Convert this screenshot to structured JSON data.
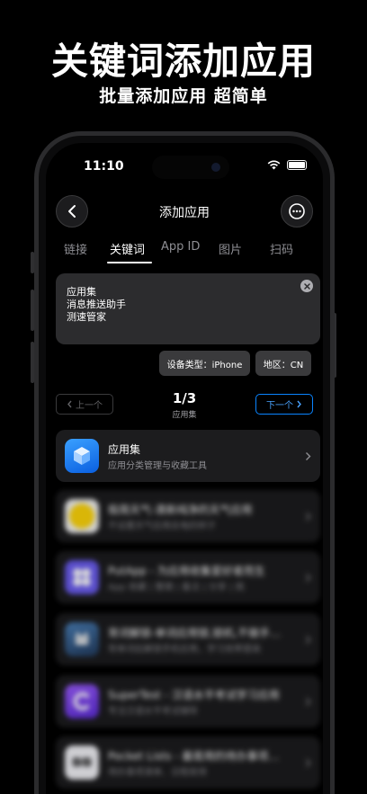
{
  "promo": {
    "title": "关键词添加应用",
    "subtitle": "批量添加应用 超简单"
  },
  "status_bar": {
    "time": "11:10"
  },
  "nav": {
    "title": "添加应用"
  },
  "tabs": [
    {
      "label": "链接"
    },
    {
      "label": "关键词"
    },
    {
      "label": "App ID"
    },
    {
      "label": "图片"
    },
    {
      "label": "扫码"
    }
  ],
  "active_tab": "关键词",
  "keyword_input": {
    "lines": [
      "应用集",
      "消息推送助手",
      "测速管家"
    ]
  },
  "filters": {
    "device": "设备类型：iPhone",
    "region": "地区：CN"
  },
  "pager": {
    "prev_label": "上一个",
    "next_label": "下一个",
    "count": "1/3",
    "caption": "应用集"
  },
  "apps": [
    {
      "name": "应用集",
      "desc": "应用分类管理与收藏工具",
      "icon": "cube-icon",
      "color": "#1e88ff"
    },
    {
      "name": "极简天气-清新纯净的天气应用",
      "desc": "不设置天气应用去电的样子",
      "icon": "sun-icon",
      "color": "#ffd60a"
    },
    {
      "name": "PutApp - 为应用收集爱好者而生",
      "desc": "App 收藏 | 整理 | 备注 | 分享 | 挑",
      "icon": "grid-icon",
      "color": "#5e5ce6"
    },
    {
      "name": "背词解锁-单词应用锁,锁机,不做手…",
      "desc": "背单词后解锁手机应用，学习效率提高",
      "icon": "cat-icon",
      "color": "#3a5f8a"
    },
    {
      "name": "SuperTest - 汉语水平考试学习应用",
      "desc": "专注汉语水平考试辅导",
      "icon": "c-logo-icon",
      "color": "#7b3ff2"
    },
    {
      "name": "Pocket Lists - 最易用的待办事项…",
      "desc": "待办事项清单、日程安排",
      "icon": "checklist-icon",
      "color": "#f2f2f7"
    }
  ]
}
